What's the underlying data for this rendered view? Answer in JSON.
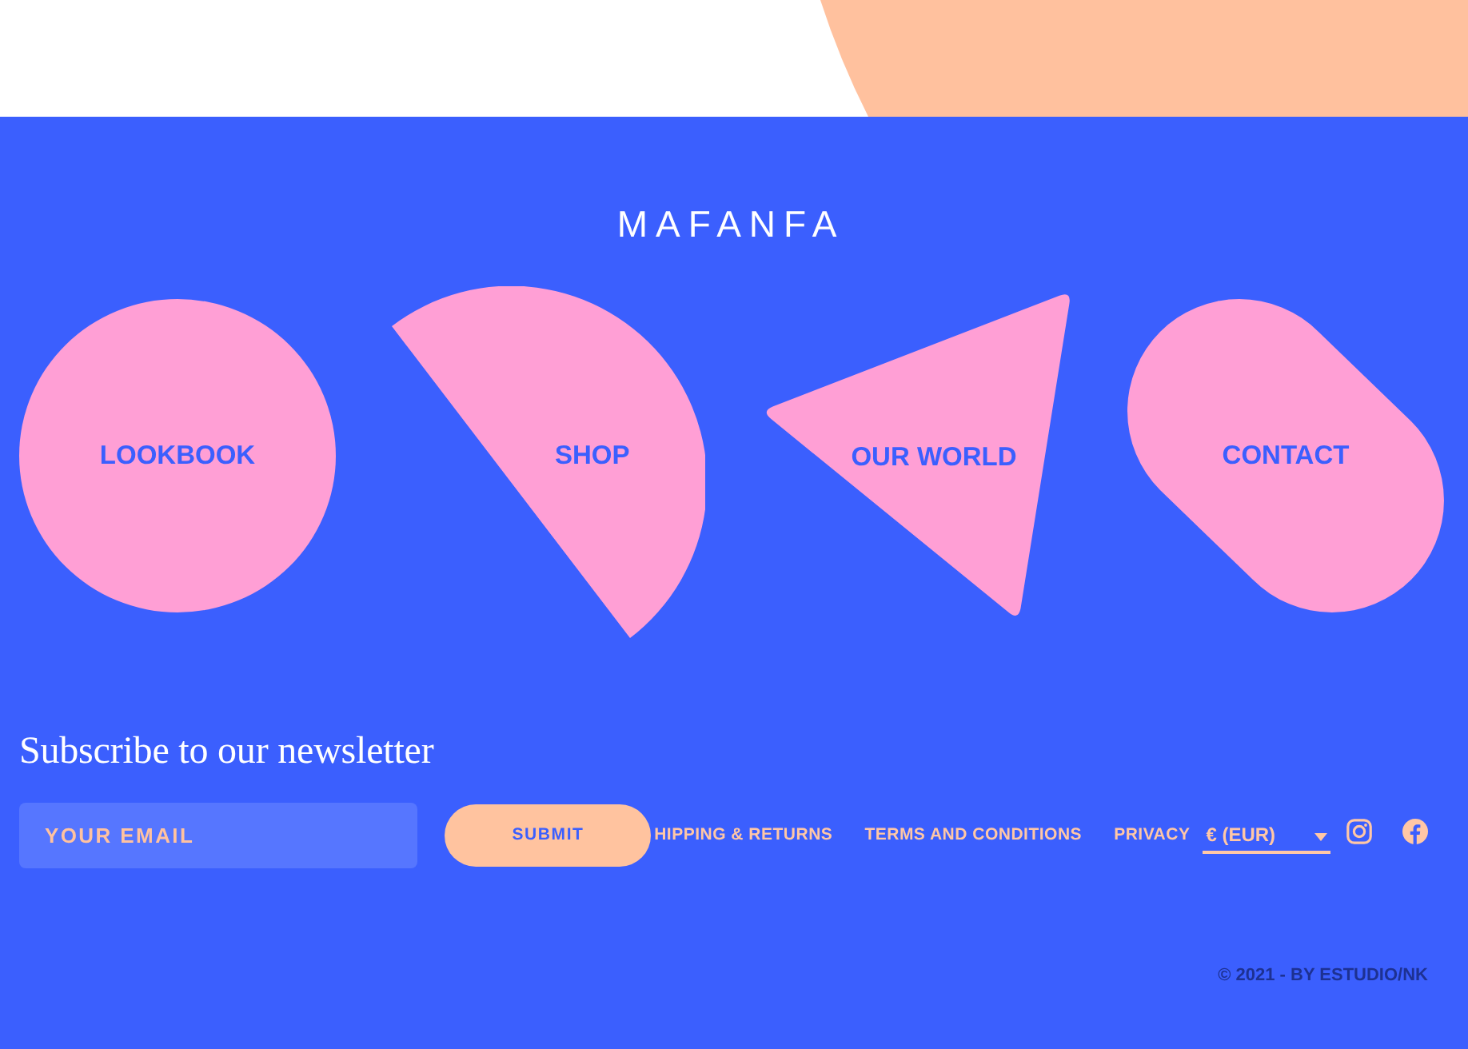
{
  "logo": {
    "text": "MAFANFA"
  },
  "nav": [
    {
      "label": "LOOKBOOK",
      "kind": "circle"
    },
    {
      "label": "SHOP",
      "kind": "half-circle"
    },
    {
      "label": "OUR WORLD",
      "kind": "triangle"
    },
    {
      "label": "CONTACT",
      "kind": "pill"
    }
  ],
  "newsletter": {
    "title": "Subscribe to our newsletter",
    "email": {
      "placeholder": "YOUR EMAIL"
    },
    "button": "SUBMIT"
  },
  "footer_links": [
    "HIPPING & RETURNS",
    "TERMS AND CONDITIONS",
    "PRIVACY"
  ],
  "currency": {
    "value": "€ (EUR)"
  },
  "copyright": "© 2021 - BY ESTUDIO/NK"
}
